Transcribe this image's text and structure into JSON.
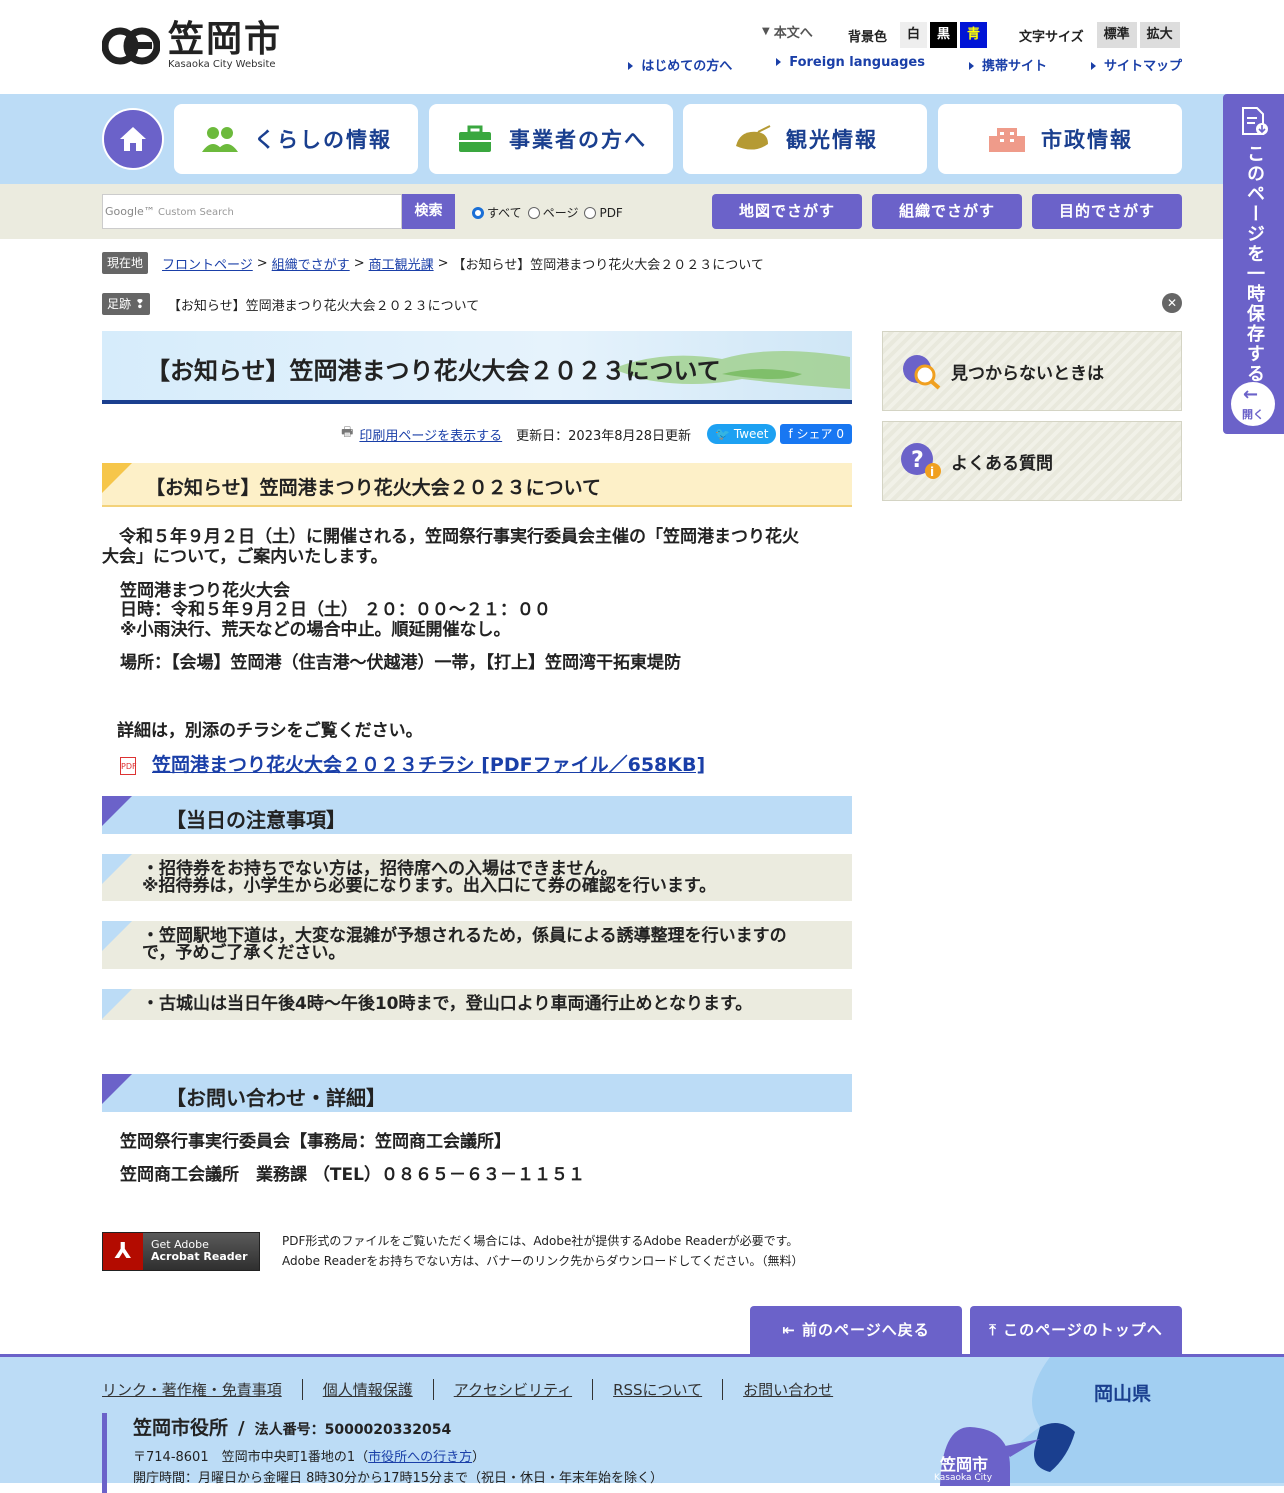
{
  "header": {
    "logo_jp": "笠岡市",
    "logo_en": "Kasaoka City Website",
    "skip": "本文へ",
    "bg_label": "背景色",
    "bg_white": "白",
    "bg_black": "黒",
    "bg_blue": "青",
    "font_label": "文字サイズ",
    "font_std": "標準",
    "font_large": "拡大",
    "links": [
      "はじめての方へ",
      "Foreign languages",
      "携帯サイト",
      "サイトマップ"
    ]
  },
  "gnav": {
    "items": [
      "くらしの情報",
      "事業者の方へ",
      "観光情報",
      "市政情報"
    ]
  },
  "search": {
    "placeholder": "Custom Search",
    "button": "検索",
    "options": [
      "すべて",
      "ページ",
      "PDF"
    ],
    "find_buttons": [
      "地図でさがす",
      "組織でさがす",
      "目的でさがす"
    ]
  },
  "sidetab": {
    "label": "このページを一時保存する",
    "open": "開く"
  },
  "breadcrumb": {
    "tag": "現在地",
    "items": [
      "フロントページ",
      "組織でさがす",
      "商工観光課"
    ],
    "current": "【お知らせ】笠岡港まつり花火大会２０２３について"
  },
  "footprint": {
    "tag": "足跡",
    "item": "【お知らせ】笠岡港まつり花火大会２０２３について"
  },
  "article": {
    "title": "【お知らせ】笠岡港まつり花火大会２０２３について",
    "print": "印刷用ページを表示する",
    "updated": "更新日：2023年8月28日更新",
    "tweet": "Tweet",
    "share": "シェア 0",
    "h2": "【お知らせ】笠岡港まつり花火大会２０２３について",
    "intro1": "　令和５年９月２日（土）に開催される，笠岡祭行事実行委員会主催の「笠岡港まつり花火",
    "intro2": "大会」について，ご案内いたします。",
    "event_name": "笠岡港まつり花火大会",
    "event_date": "日時：令和５年９月２日（土） ２０：００～２１：００",
    "event_note": "※小雨決行、荒天などの場合中止。順延開催なし。",
    "place": "場所：【会場】笠岡港（住吉港～伏越港）一帯，【打上】笠岡湾干拓東堤防",
    "details": "詳細は，別添のチラシをご覧ください。",
    "pdf_link": "笠岡港まつり花火大会２０２３チラシ [PDFファイル／658KB]",
    "h3_notes": "【当日の注意事項】",
    "note1a": "・招待券をお持ちでない方は，招待席への入場はできません。",
    "note1b": "※招待券は，小学生から必要になります。出入口にて券の確認を行います。",
    "note2a": "・笠岡駅地下道は，大変な混雑が予想されるため，係員による誘導整理を行いますの",
    "note2b": "で，予めご了承ください。",
    "note3": "・古城山は当日午後4時～午後10時まで，登山口より車両通行止めとなります。",
    "h3_contact": "【お問い合わせ・詳細】",
    "contact1": "笠岡祭行事実行委員会【事務局：笠岡商工会議所】",
    "contact2": "笠岡商工会議所　業務課 （TEL）０８６５－６３－１１５１",
    "adobe_btn1": "Get Adobe",
    "adobe_btn2": "Acrobat Reader",
    "adobe_text1": "PDF形式のファイルをご覧いただく場合には、Adobe社が提供するAdobe Readerが必要です。",
    "adobe_text2": "Adobe Readerをお持ちでない方は、バナーのリンク先からダウンロードしてください。（無料）"
  },
  "sidebar": {
    "items": [
      "見つからないときは",
      "よくある質問"
    ]
  },
  "pager": {
    "back": "前のページへ戻る",
    "top": "このページのトップへ"
  },
  "footer": {
    "links": [
      "リンク・著作権・免責事項",
      "個人情報保護",
      "アクセシビリティ",
      "RSSについて",
      "お問い合わせ"
    ],
    "office": "笠岡市役所",
    "slash": "/",
    "corp": "法人番号：5000020332054",
    "address_pre": "〒714-8601　笠岡市中央町1番地の1（",
    "address_link": "市役所への行き方",
    "address_post": "）",
    "hours": "開庁時間：月曜日から金曜日 8時30分から17時15分まで（祝日・休日・年末年始を除く）",
    "map_pref": "岡山県",
    "map_city": "笠岡市",
    "map_city_en": "Kasaoka City"
  },
  "colors": {
    "accent": "#6b62c9",
    "nav_bg": "#bcdcf6",
    "search_bg": "#ebebdf",
    "link": "#1a3fa8"
  }
}
